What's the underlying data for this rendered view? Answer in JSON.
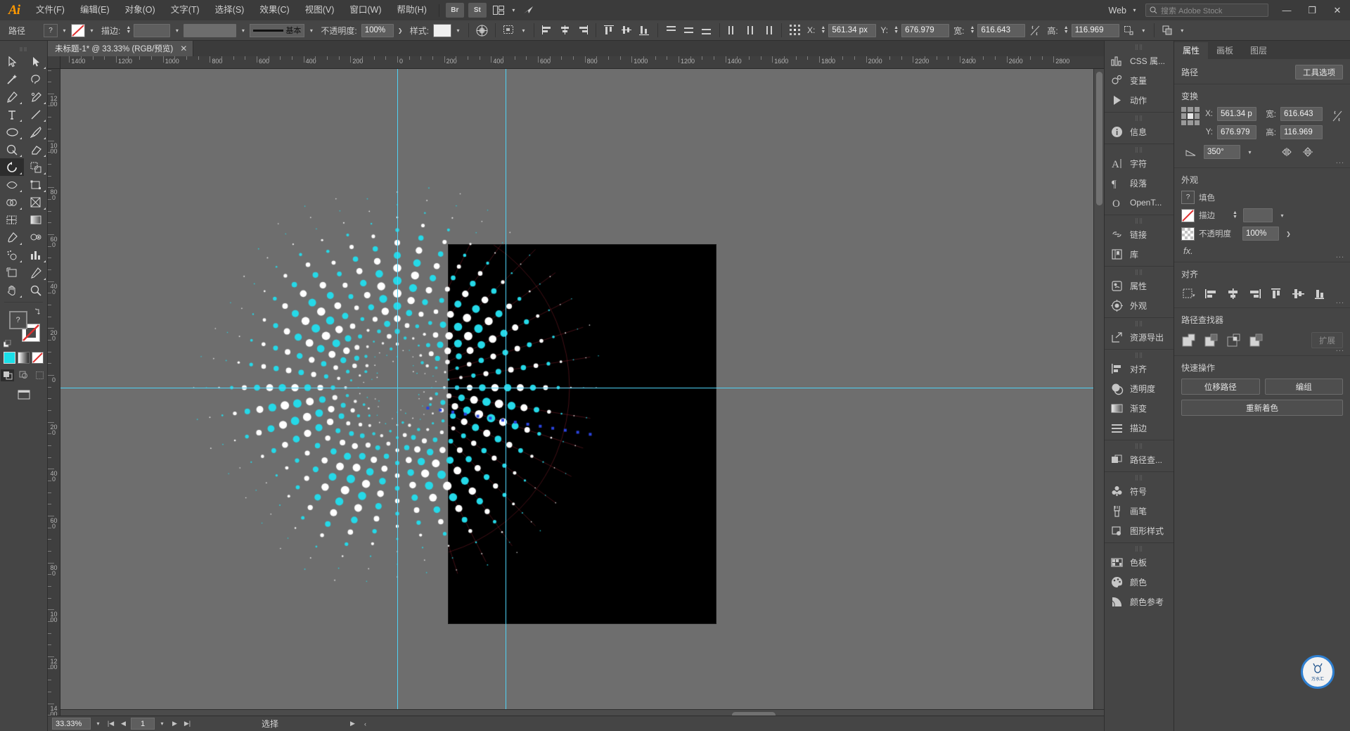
{
  "app": {
    "name": "Adobe Illustrator",
    "logo": "Ai"
  },
  "menubar": {
    "items": [
      "文件(F)",
      "编辑(E)",
      "对象(O)",
      "文字(T)",
      "选择(S)",
      "效果(C)",
      "视图(V)",
      "窗口(W)",
      "帮助(H)"
    ],
    "quick_icons": [
      "Br",
      "St"
    ],
    "arrange_icon": "arrange-documents-icon",
    "behance_icon": "behance-icon",
    "workspace": "Web",
    "search_placeholder": "搜索 Adobe Stock",
    "window_buttons": [
      "minimize",
      "restore",
      "close"
    ]
  },
  "optionsbar": {
    "object_label": "路径",
    "fill_swatch": "?",
    "stroke_swatch": "none-red-slash",
    "stroke_label": "描边:",
    "stroke_weight": "",
    "stroke_profile_label": "基本",
    "opacity_label": "不透明度:",
    "opacity_value": "100%",
    "style_label": "样式:",
    "recolor_icon": "recolor-artwork-icon",
    "select_similar_icon": "select-similar-icon",
    "x_label": "X:",
    "x_value": "561.34 px",
    "y_label": "Y:",
    "y_value": "676.979",
    "w_label": "宽:",
    "w_value": "616.643",
    "h_label": "高:",
    "h_value": "116.969",
    "link_icon": "constrain-proportions-unlinked-icon",
    "transform_icon": "transform-icon"
  },
  "toolbar": {
    "tools": [
      {
        "name": "selection-tool",
        "label": "选择工具"
      },
      {
        "name": "direct-selection-tool",
        "label": "直接选择工具"
      },
      {
        "name": "magic-wand-tool",
        "label": "魔棒工具"
      },
      {
        "name": "lasso-tool",
        "label": "套索工具"
      },
      {
        "name": "pen-tool",
        "label": "钢笔工具"
      },
      {
        "name": "curvature-tool",
        "label": "曲率工具"
      },
      {
        "name": "type-tool",
        "label": "文字工具"
      },
      {
        "name": "line-segment-tool",
        "label": "直线段工具"
      },
      {
        "name": "ellipse-tool",
        "label": "椭圆工具"
      },
      {
        "name": "paintbrush-tool",
        "label": "画笔工具"
      },
      {
        "name": "shaper-tool",
        "label": "Shaper 工具"
      },
      {
        "name": "eraser-tool",
        "label": "橡皮擦工具"
      },
      {
        "name": "rotate-tool",
        "label": "旋转工具",
        "selected": true
      },
      {
        "name": "scale-tool",
        "label": "比例缩放工具"
      },
      {
        "name": "width-tool",
        "label": "宽度工具"
      },
      {
        "name": "free-transform-tool",
        "label": "自由变换工具"
      },
      {
        "name": "shape-builder-tool",
        "label": "形状生成器工具"
      },
      {
        "name": "perspective-grid-tool",
        "label": "透视网格工具"
      },
      {
        "name": "mesh-tool",
        "label": "网格工具"
      },
      {
        "name": "gradient-tool",
        "label": "渐变工具"
      },
      {
        "name": "eyedropper-tool",
        "label": "吸管工具"
      },
      {
        "name": "blend-tool",
        "label": "混合工具"
      },
      {
        "name": "symbol-sprayer-tool",
        "label": "符号喷枪工具"
      },
      {
        "name": "column-graph-tool",
        "label": "柱形图工具"
      },
      {
        "name": "artboard-tool",
        "label": "画板工具"
      },
      {
        "name": "slice-tool",
        "label": "切片工具"
      },
      {
        "name": "hand-tool",
        "label": "抓手工具"
      },
      {
        "name": "zoom-tool",
        "label": "缩放工具"
      }
    ],
    "fill_color": "#4a4a4a",
    "stroke_color": "none",
    "color_mode_swatches": [
      "#1ae0e8",
      "gradient",
      "none"
    ],
    "draw_modes": [
      "draw-normal",
      "draw-behind",
      "draw-inside"
    ],
    "screen_mode_icon": "change-screen-mode-icon"
  },
  "document": {
    "tab_title": "未标题-1* @ 33.33% (RGB/预览)",
    "close_icon": "close-tab-icon",
    "zoom": "33.33%",
    "color_mode": "RGB/预览"
  },
  "rulers": {
    "horizontal_labels": [
      "1600",
      "1400",
      "1200",
      "1000",
      "800",
      "600",
      "400",
      "200",
      "0",
      "200",
      "400",
      "600",
      "800",
      "1000",
      "1200",
      "1400",
      "1600",
      "1800",
      "2000",
      "2200",
      "2400",
      "2600"
    ],
    "vertical_labels": [
      "800",
      "600",
      "400",
      "200",
      "0",
      "200",
      "400",
      "600",
      "800",
      "1000",
      "1200",
      "1400",
      "1600",
      "1800",
      "2000"
    ]
  },
  "canvas": {
    "artboard_color": "#000000",
    "stage_color": "#6e6e6e",
    "guide_color": "#4fd2f5",
    "artwork": {
      "description": "radial-dot-burst",
      "dot_colors": [
        "#25d9e8",
        "#ffffff",
        "#14c4e0"
      ],
      "rays": 40,
      "dots_per_ray": 14,
      "selection_color": "#2a44dd"
    }
  },
  "statusbar": {
    "zoom_value": "33.33%",
    "page_value": "1",
    "status_text": "选择",
    "nav_first": "first-page-icon",
    "nav_prev": "prev-page-icon",
    "nav_next": "next-page-icon",
    "nav_last": "last-page-icon"
  },
  "icondock": {
    "groups": [
      {
        "items": [
          {
            "icon": "css-properties-icon",
            "label": "CSS 属..."
          },
          {
            "icon": "variables-icon",
            "label": "变量"
          },
          {
            "icon": "actions-icon",
            "label": "动作"
          }
        ]
      },
      {
        "items": [
          {
            "icon": "info-icon",
            "label": "信息"
          }
        ]
      },
      {
        "items": [
          {
            "icon": "character-icon",
            "label": "字符"
          },
          {
            "icon": "paragraph-icon",
            "label": "段落"
          },
          {
            "icon": "opentype-icon",
            "label": "OpenT..."
          }
        ]
      },
      {
        "items": [
          {
            "icon": "links-icon",
            "label": "链接"
          },
          {
            "icon": "libraries-icon",
            "label": "库"
          }
        ]
      },
      {
        "items": [
          {
            "icon": "properties-icon",
            "label": "属性"
          },
          {
            "icon": "appearance-icon",
            "label": "外观"
          }
        ]
      },
      {
        "items": [
          {
            "icon": "asset-export-icon",
            "label": "资源导出"
          }
        ]
      },
      {
        "items": [
          {
            "icon": "align-icon",
            "label": "对齐"
          },
          {
            "icon": "transparency-icon",
            "label": "透明度"
          },
          {
            "icon": "gradient-icon",
            "label": "渐变"
          },
          {
            "icon": "stroke-icon",
            "label": "描边"
          }
        ]
      },
      {
        "items": [
          {
            "icon": "pathfinder-icon",
            "label": "路径查..."
          }
        ]
      },
      {
        "items": [
          {
            "icon": "symbols-icon",
            "label": "符号"
          },
          {
            "icon": "brushes-icon",
            "label": "画笔"
          },
          {
            "icon": "graphic-styles-icon",
            "label": "图形样式"
          }
        ]
      },
      {
        "items": [
          {
            "icon": "swatches-icon",
            "label": "色板"
          },
          {
            "icon": "color-icon",
            "label": "颜色"
          },
          {
            "icon": "color-guide-icon",
            "label": "颜色参考"
          }
        ]
      }
    ]
  },
  "properties": {
    "tabs": [
      {
        "label": "属性",
        "active": true
      },
      {
        "label": "画板",
        "active": false
      },
      {
        "label": "图层",
        "active": false
      }
    ],
    "object_section": {
      "title": "路径",
      "tool_options_button": "工具选项"
    },
    "transform": {
      "title": "变换",
      "x_label": "X:",
      "x_value": "561.34 p",
      "y_label": "Y:",
      "y_value": "676.979",
      "w_label": "宽:",
      "w_value": "616.643",
      "h_label": "高:",
      "h_value": "116.969",
      "angle_label": "angle-icon",
      "angle_value": "350°",
      "flip_h": "flip-horizontal-icon",
      "flip_v": "flip-vertical-icon",
      "link_icon": "constrain-proportions-unlinked-icon",
      "more_options": "..."
    },
    "appearance": {
      "title": "外观",
      "fill_label": "填色",
      "fill_swatch": "?",
      "stroke_label": "描边",
      "stroke_swatch": "none-red-slash",
      "stroke_weight": "",
      "opacity_label": "不透明度",
      "opacity_value": "100%",
      "fx_label": "fx.",
      "more_options": "..."
    },
    "align": {
      "title": "对齐",
      "buttons": [
        "align-to-selection-icon",
        "align-left-icon",
        "align-horizontal-center-icon",
        "align-right-icon",
        "align-top-icon",
        "align-vertical-center-icon",
        "align-bottom-icon"
      ],
      "more_options": "..."
    },
    "pathfinder": {
      "title": "路径查找器",
      "buttons": [
        "unite-icon",
        "minus-front-icon",
        "intersect-icon",
        "exclude-icon"
      ],
      "extra_button": "扩展",
      "more_options": "..."
    },
    "quick_actions": {
      "title": "快速操作",
      "buttons": [
        "位移路径",
        "编组",
        "重新着色"
      ]
    },
    "badge": {
      "text": "万水汇",
      "color": "#2f7fd0"
    }
  }
}
